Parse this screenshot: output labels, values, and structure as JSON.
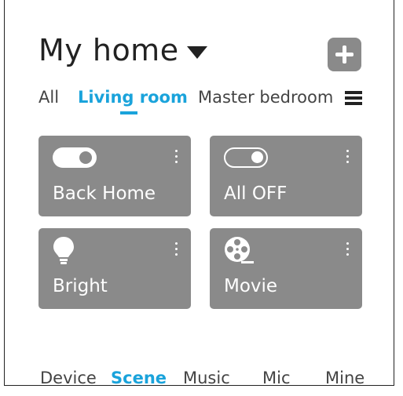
{
  "header": {
    "title": "My home",
    "add_icon": "plus-icon"
  },
  "tabs": [
    {
      "label": "All",
      "active": false
    },
    {
      "label": "Living room",
      "active": true
    },
    {
      "label": "Master bedroom",
      "active": false
    }
  ],
  "tabs_menu_icon": "hamburger-menu-icon",
  "scenes": [
    {
      "label": "Back Home",
      "icon": "toggle-on-icon"
    },
    {
      "label": "All OFF",
      "icon": "toggle-off-icon"
    },
    {
      "label": "Bright",
      "icon": "lightbulb-icon"
    },
    {
      "label": "Movie",
      "icon": "film-reel-icon"
    }
  ],
  "bottom_nav": [
    {
      "label": "Device",
      "active": false
    },
    {
      "label": "Scene",
      "active": true
    },
    {
      "label": "Music",
      "active": false
    },
    {
      "label": "Mic",
      "active": false
    },
    {
      "label": "Mine",
      "active": false
    }
  ],
  "colors": {
    "accent": "#1aa3db",
    "card": "#8a8a8a",
    "text": "#222222"
  }
}
